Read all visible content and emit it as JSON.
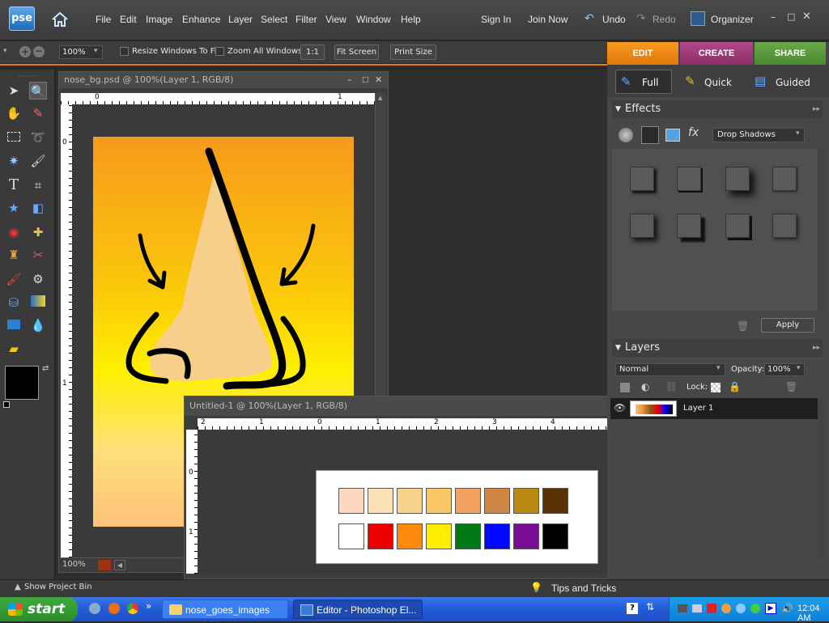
{
  "app": {
    "logo": "pse"
  },
  "menu": {
    "items": [
      "File",
      "Edit",
      "Image",
      "Enhance",
      "Layer",
      "Select",
      "Filter",
      "View",
      "Window",
      "Help"
    ],
    "sign_in": "Sign In",
    "join_now": "Join Now",
    "undo": "Undo",
    "redo": "Redo",
    "organizer": "Organizer"
  },
  "options": {
    "zoom": "100%",
    "resize_windows": "Resize Windows To Fit",
    "zoom_all": "Zoom All Windows",
    "one_to_one": "1:1",
    "fit_screen": "Fit Screen",
    "print_size": "Print Size"
  },
  "mode_tabs": {
    "edit": "EDIT",
    "create": "CREATE",
    "share": "SHARE"
  },
  "edit_modes": {
    "full": "Full",
    "quick": "Quick",
    "guided": "Guided"
  },
  "effects": {
    "title": "Effects",
    "dropdown": "Drop Shadows",
    "apply": "Apply"
  },
  "layers": {
    "title": "Layers",
    "blend": "Normal",
    "opacity_label": "Opacity:",
    "opacity": "100%",
    "lock_label": "Lock:",
    "layer_name": "Layer 1"
  },
  "doc1": {
    "title": "nose_bg.psd @ 100%(Layer 1, RGB/8)",
    "zoom": "100%",
    "ruler_top": [
      "0",
      "1"
    ],
    "ruler_left": [
      "0",
      "1"
    ]
  },
  "doc2": {
    "title": "Untitled-1 @ 100%(Layer 1, RGB/8)",
    "ruler_top": [
      "2",
      "1",
      "0",
      "1",
      "2",
      "3",
      "4"
    ],
    "ruler_left": [
      "0",
      "1"
    ]
  },
  "palette": {
    "row1": [
      "#fdd8c0",
      "#fde2b8",
      "#f7d38e",
      "#fbc766",
      "#f2a25e",
      "#cd8646",
      "#b88a14",
      "#5a3005"
    ],
    "row2": [
      "#ffffff",
      "#ee0000",
      "#ff8a0e",
      "#ffee00",
      "#007a14",
      "#0008ff",
      "#7a0d93",
      "#000000"
    ]
  },
  "status": {
    "project_bin": "Show Project Bin",
    "tips": "Tips and Tricks"
  },
  "taskbar": {
    "start": "start",
    "task1": "nose_goes_images",
    "task2": "Editor - Photoshop El...",
    "clock": "12:04 AM"
  }
}
